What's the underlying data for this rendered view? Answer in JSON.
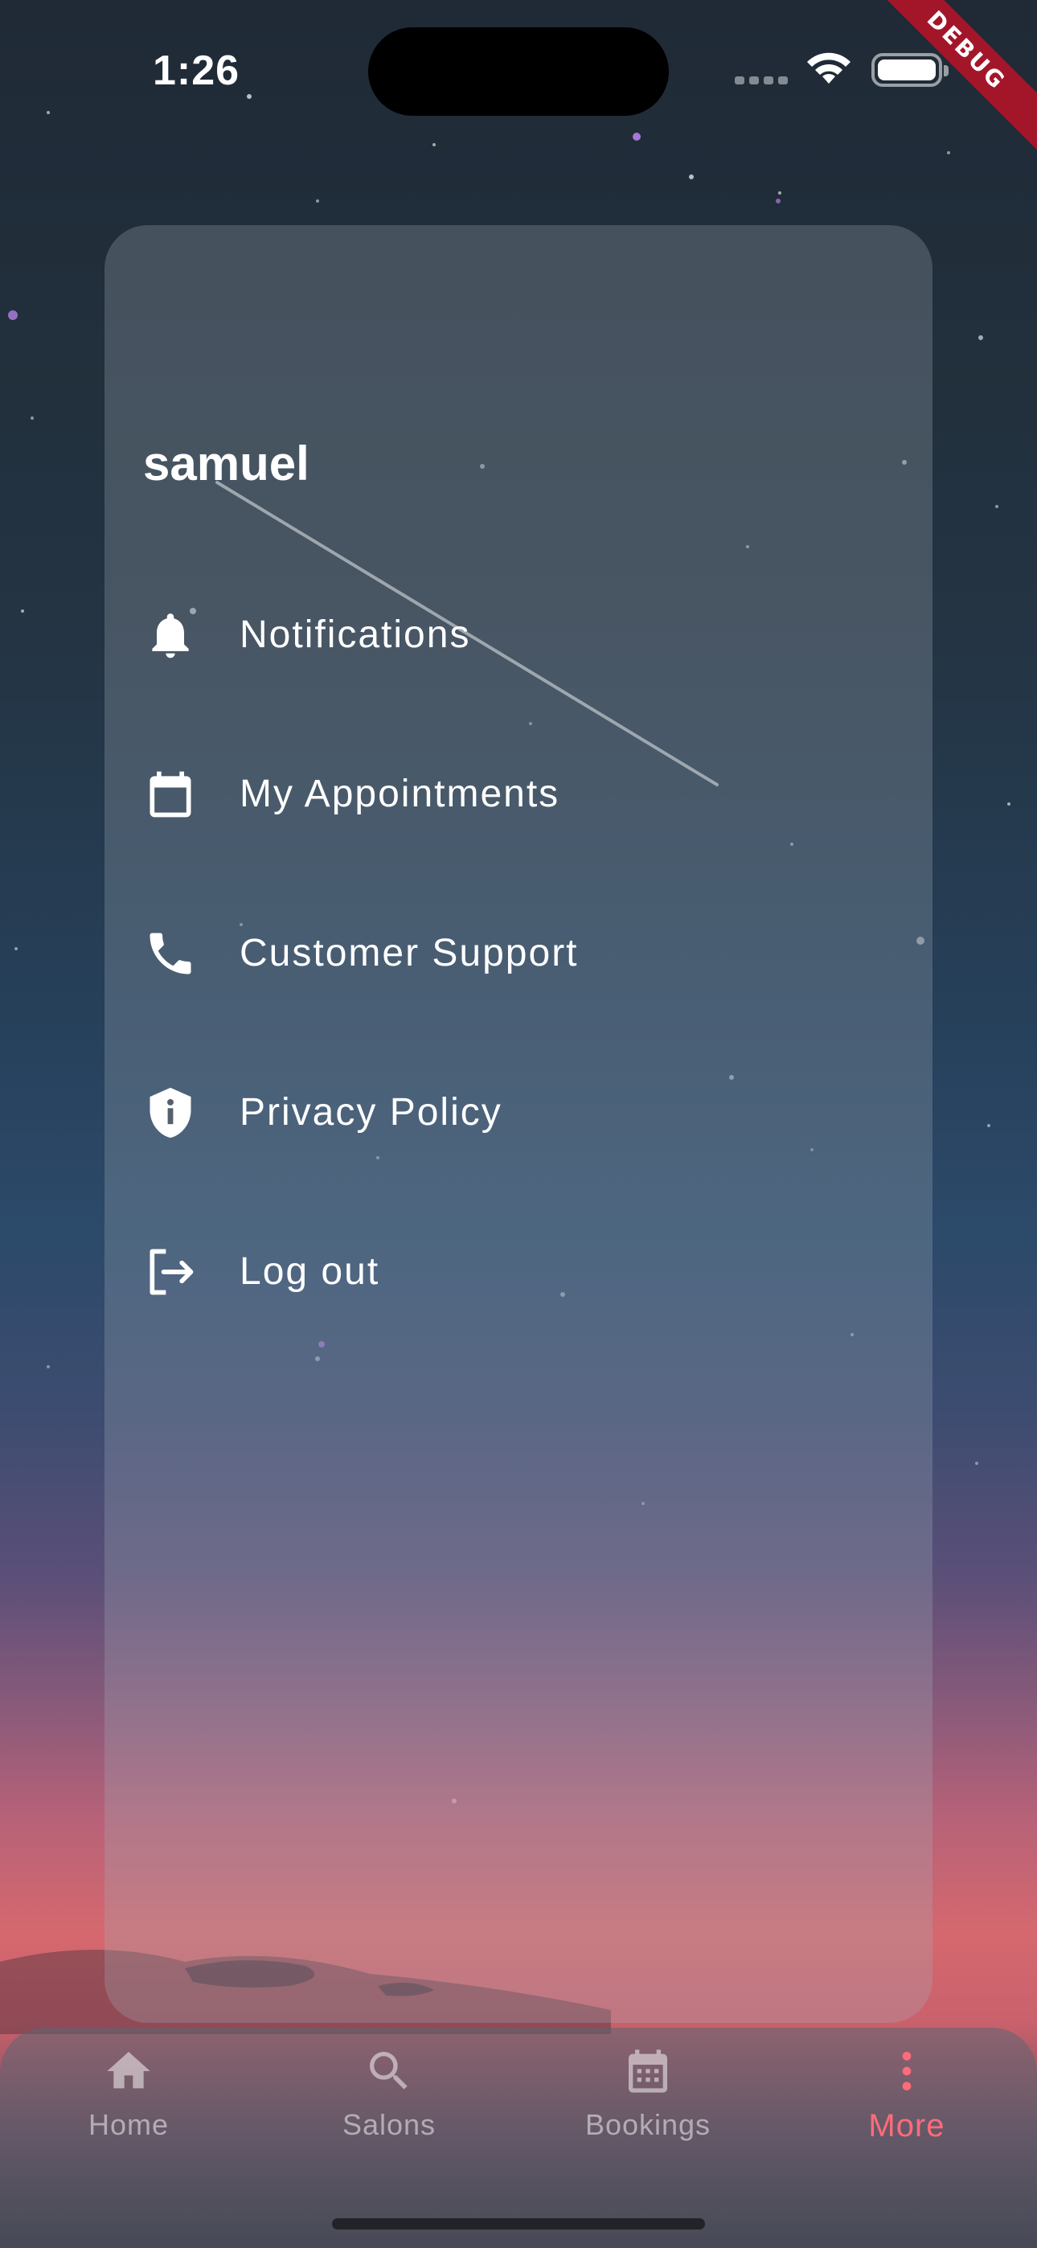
{
  "status_bar": {
    "time": "1:26"
  },
  "debug_banner": "DEBUG",
  "drawer": {
    "user_name": "samuel",
    "items": [
      {
        "label": "Notifications",
        "icon": "bell-icon"
      },
      {
        "label": "My Appointments",
        "icon": "calendar-icon"
      },
      {
        "label": "Customer Support",
        "icon": "phone-icon"
      },
      {
        "label": "Privacy Policy",
        "icon": "shield-info-icon"
      },
      {
        "label": "Log out",
        "icon": "logout-icon"
      }
    ]
  },
  "bottom_nav": {
    "items": [
      {
        "label": "Home",
        "icon": "home-icon",
        "active": false
      },
      {
        "label": "Salons",
        "icon": "search-icon",
        "active": false
      },
      {
        "label": "Bookings",
        "icon": "calendar-grid-icon",
        "active": false
      },
      {
        "label": "More",
        "icon": "more-vertical-icon",
        "active": true
      }
    ]
  },
  "colors": {
    "active_tab": "#ff6b7a",
    "inactive_tab": "#a7a9b2",
    "debug_banner": "#a3162a"
  }
}
